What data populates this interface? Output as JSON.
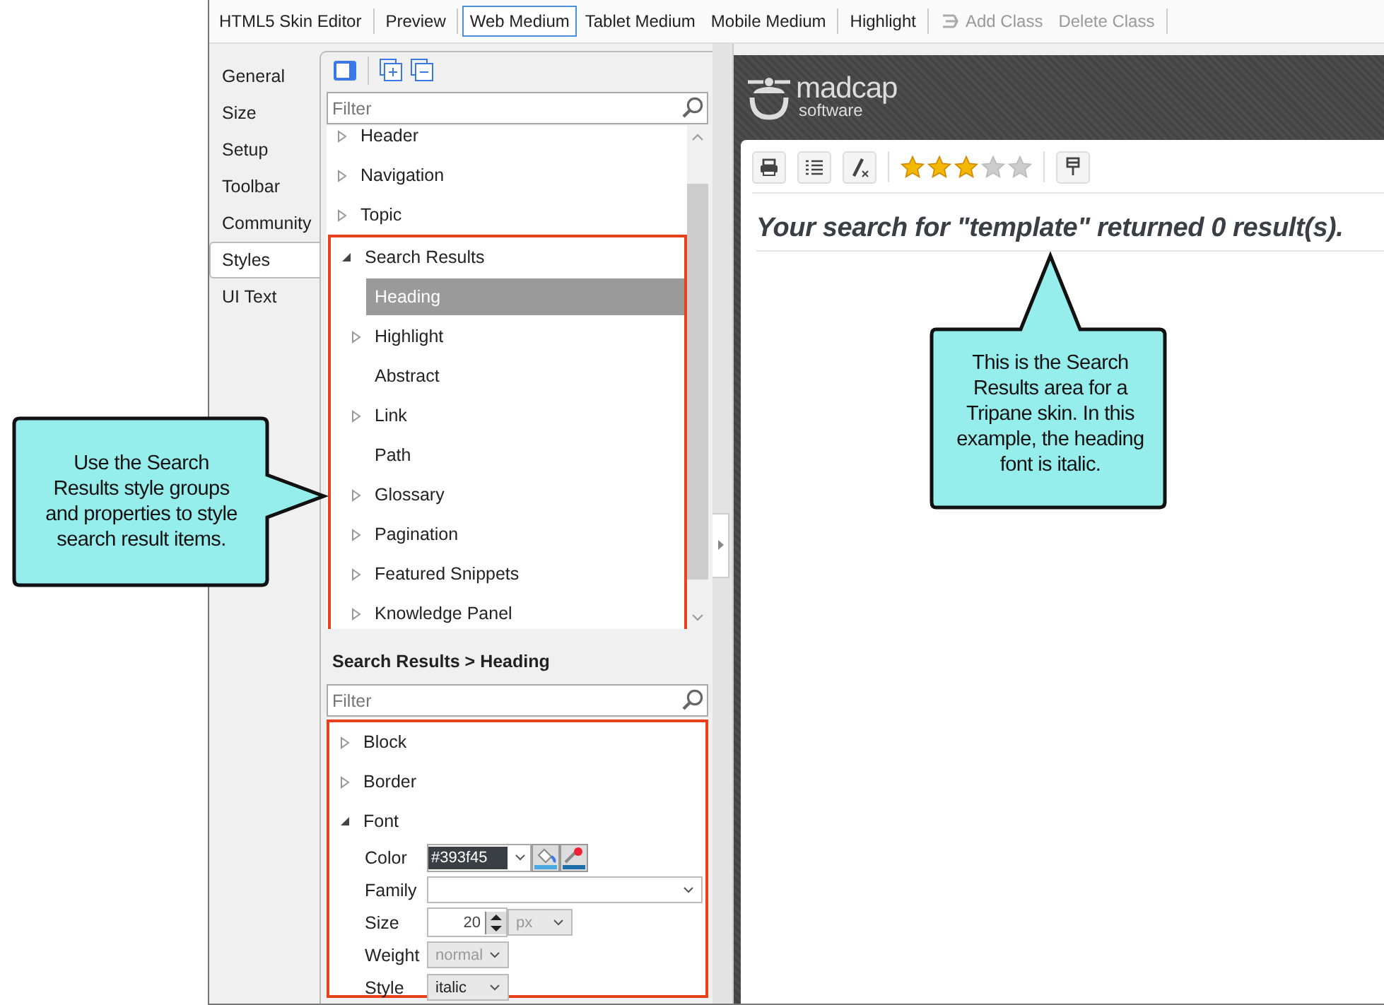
{
  "toolbar": {
    "groups": [
      [
        {
          "label": "HTML5 Skin Editor",
          "kind": "button",
          "selected": false,
          "disabled": false
        }
      ],
      [
        {
          "label": "Preview",
          "kind": "button",
          "selected": false,
          "disabled": false
        }
      ],
      [
        {
          "label": "Web Medium",
          "kind": "button",
          "selected": true,
          "disabled": false
        },
        {
          "label": "Tablet Medium",
          "kind": "button",
          "selected": false,
          "disabled": false
        },
        {
          "label": "Mobile Medium",
          "kind": "button",
          "selected": false,
          "disabled": false
        }
      ],
      [
        {
          "label": "Highlight",
          "kind": "button",
          "selected": false,
          "disabled": false
        }
      ],
      [
        {
          "label": "Add Class",
          "kind": "icon_button",
          "selected": false,
          "disabled": true
        },
        {
          "label": "Delete Class",
          "kind": "button",
          "selected": false,
          "disabled": true
        }
      ]
    ]
  },
  "side_tabs": [
    {
      "label": "General",
      "selected": false
    },
    {
      "label": "Size",
      "selected": false
    },
    {
      "label": "Setup",
      "selected": false
    },
    {
      "label": "Toolbar",
      "selected": false
    },
    {
      "label": "Community",
      "selected": false
    },
    {
      "label": "Styles",
      "selected": true
    },
    {
      "label": "UI Text",
      "selected": false
    }
  ],
  "style_tree": {
    "filter": {
      "placeholder": "Filter"
    },
    "items": [
      {
        "label": "Header",
        "expanded": false,
        "selected": false
      },
      {
        "label": "Navigation",
        "expanded": false,
        "selected": false
      },
      {
        "label": "Topic",
        "expanded": false,
        "selected": false
      },
      {
        "label": "Search Results",
        "expanded": true,
        "selected": false,
        "children": [
          {
            "label": "Heading",
            "selected": true
          },
          {
            "label": "Highlight",
            "expanded": false,
            "selected": false
          },
          {
            "label": "Abstract",
            "selected": false
          },
          {
            "label": "Link",
            "expanded": false,
            "selected": false
          },
          {
            "label": "Path",
            "selected": false
          },
          {
            "label": "Glossary",
            "expanded": false,
            "selected": false
          },
          {
            "label": "Pagination",
            "expanded": false,
            "selected": false
          },
          {
            "label": "Featured Snippets",
            "expanded": false,
            "selected": false
          },
          {
            "label": "Knowledge Panel",
            "expanded": false,
            "selected": false
          }
        ]
      }
    ]
  },
  "properties": {
    "title": "Search Results > Heading",
    "filter": {
      "placeholder": "Filter"
    },
    "groups": [
      {
        "label": "Block",
        "expanded": false
      },
      {
        "label": "Border",
        "expanded": false
      },
      {
        "label": "Font",
        "expanded": true,
        "fields": [
          {
            "label": "Color",
            "kind": "color",
            "value": "#393f45"
          },
          {
            "label": "Family",
            "kind": "select",
            "disabled": false
          },
          {
            "label": "Size",
            "kind": "number",
            "value": "20",
            "unit": {
              "value": "px",
              "disabled": true
            }
          },
          {
            "label": "Weight",
            "kind": "select",
            "value": "normal",
            "disabled": true
          },
          {
            "label": "Style",
            "kind": "select",
            "value": "italic",
            "disabled": false
          }
        ]
      }
    ]
  },
  "preview": {
    "logo": {
      "name": "madcap",
      "tagline": "software"
    },
    "stars": 3,
    "heading": "Your search for \"template\" returned 0 result(s)."
  },
  "callouts": [
    {
      "text": "Use the Search Results style groups and properties to style search result items."
    },
    {
      "text": "This is the Search Results area for a Tripane skin. In this example, the heading font is italic."
    }
  ]
}
